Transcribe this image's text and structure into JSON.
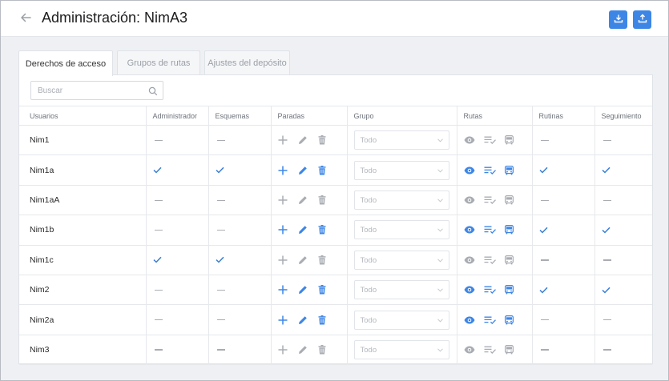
{
  "header": {
    "title": "Administración: NimA3"
  },
  "tabs": [
    {
      "label": "Derechos de acceso",
      "active": true
    },
    {
      "label": "Grupos de rutas",
      "active": false
    },
    {
      "label": "Ajustes del depósito",
      "active": false
    }
  ],
  "search": {
    "placeholder": "Buscar",
    "value": ""
  },
  "columns": [
    "Usuarios",
    "Administrador",
    "Esquemas",
    "Paradas",
    "Grupo",
    "Rutas",
    "Rutinas",
    "Seguimiento"
  ],
  "colors": {
    "accent": "#3d86e6",
    "check": "#3a7fd8",
    "muted": "#a9adb3"
  },
  "rows": [
    {
      "name": "Nim1",
      "admin": false,
      "esquemas": false,
      "paradas": false,
      "grupo": "Todo",
      "rutas": false,
      "rutinas": false,
      "seguimiento": false
    },
    {
      "name": "Nim1a",
      "admin": true,
      "esquemas": true,
      "paradas": true,
      "grupo": "Todo",
      "rutas": true,
      "rutinas": true,
      "seguimiento": true
    },
    {
      "name": "Nim1aA",
      "admin": false,
      "esquemas": false,
      "paradas": false,
      "grupo": "Todo",
      "rutas": false,
      "rutinas": false,
      "seguimiento": false
    },
    {
      "name": "Nim1b",
      "admin": false,
      "esquemas": false,
      "paradas": true,
      "grupo": "Todo",
      "rutas": true,
      "rutinas": true,
      "seguimiento": true
    },
    {
      "name": "Nim1c",
      "admin": true,
      "esquemas": true,
      "paradas": false,
      "grupo": "Todo",
      "rutas": false,
      "rutinas": false,
      "seguimiento": false
    },
    {
      "name": "Nim2",
      "admin": false,
      "esquemas": false,
      "paradas": true,
      "grupo": "Todo",
      "rutas": true,
      "rutinas": true,
      "seguimiento": true
    },
    {
      "name": "Nim2a",
      "admin": false,
      "esquemas": false,
      "paradas": true,
      "grupo": "Todo",
      "rutas": true,
      "rutinas": false,
      "seguimiento": false
    },
    {
      "name": "Nim3",
      "admin": false,
      "esquemas": false,
      "paradas": false,
      "grupo": "Todo",
      "rutas": false,
      "rutinas": false,
      "seguimiento": false
    }
  ]
}
